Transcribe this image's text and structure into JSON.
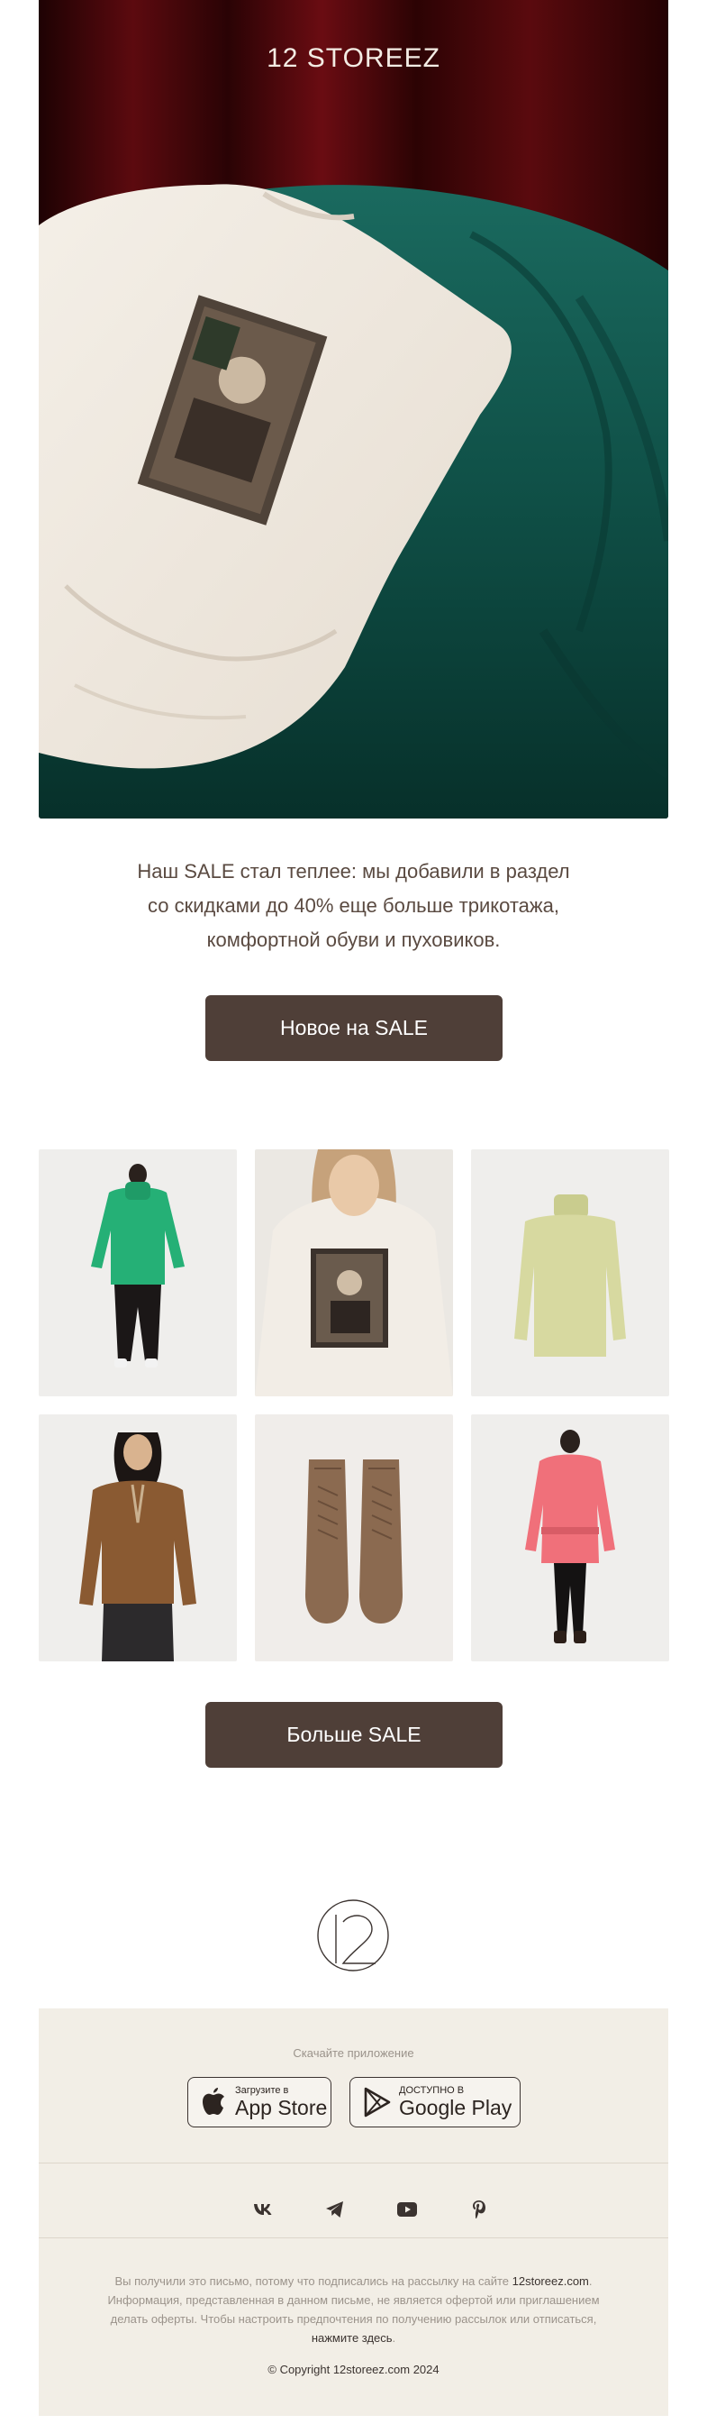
{
  "hero": {
    "brand": "12 STOREEZ"
  },
  "intro": {
    "line1": "Наш SALE стал теплее: мы добавили в раздел",
    "line2": "со скидками до 40% еще больше трикотажа,",
    "line3": "комфортной обуви и пуховиков."
  },
  "buttons": {
    "new_on_sale": "Новое на SALE",
    "more_sale": "Больше SALE"
  },
  "products": [
    {
      "name": "green-puffer-jacket"
    },
    {
      "name": "printed-sweatshirt"
    },
    {
      "name": "pistachio-turtleneck"
    },
    {
      "name": "brown-knit-half-zip"
    },
    {
      "name": "brown-suede-boots"
    },
    {
      "name": "pink-puffer-jacket"
    }
  ],
  "footer": {
    "download_label": "Скачайте приложение",
    "appstore": {
      "small": "Загрузите в",
      "big": "App Store"
    },
    "googleplay": {
      "small": "ДОСТУПНО В",
      "big": "Google Play"
    },
    "social_icons": [
      "vk-icon",
      "telegram-icon",
      "youtube-icon",
      "pinterest-icon"
    ],
    "legal_1": "Вы получили это письмо, потому что подписались на рассылку на сайте",
    "legal_site": "12storeez.com",
    "legal_2": "Информация, представленная в данном письме, не является офертой или приглашением делать оферты. Чтобы настроить предпочтения по получению рассылок или отписаться,",
    "legal_link": "нажмите здесь",
    "copyright": "© Copyright 12storeez.com 2024"
  },
  "colors": {
    "button": "#4f3f38",
    "footer_bg": "#f2eee6",
    "tile_bg": "#efeeec",
    "velvet_green": "#0f4d45",
    "curtain_red": "#4a0709"
  }
}
